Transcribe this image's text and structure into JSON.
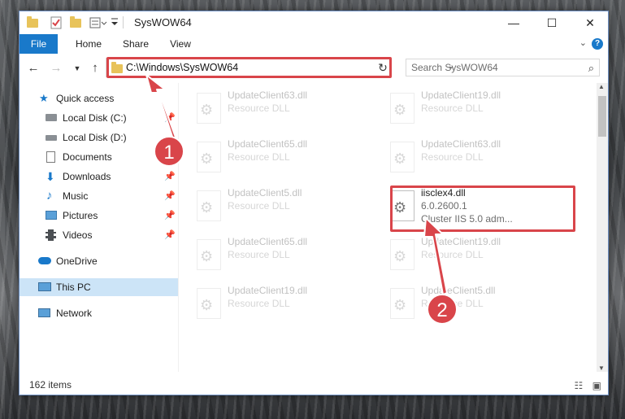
{
  "window": {
    "title": "SysWOW64",
    "controls": {
      "minimize": "—",
      "maximize": "☐",
      "close": "✕"
    }
  },
  "ribbon": {
    "tabs": [
      "File",
      "Home",
      "Share",
      "View"
    ],
    "help": "?"
  },
  "navigation": {
    "address": "C:\\Windows\\SysWOW64",
    "search_placeholder": "Search SysWOW64"
  },
  "sidebar": {
    "items": [
      {
        "label": "Quick access",
        "icon": "star-icon"
      },
      {
        "label": "Local Disk (C:)",
        "icon": "drive-icon",
        "pinned": true
      },
      {
        "label": "Local Disk (D:)",
        "icon": "drive-icon",
        "pinned": false
      },
      {
        "label": "Documents",
        "icon": "documents-icon",
        "pinned": true
      },
      {
        "label": "Downloads",
        "icon": "download-icon",
        "pinned": true
      },
      {
        "label": "Music",
        "icon": "music-icon",
        "pinned": true
      },
      {
        "label": "Pictures",
        "icon": "pictures-icon",
        "pinned": true
      },
      {
        "label": "Videos",
        "icon": "videos-icon",
        "pinned": true
      },
      {
        "label": "OneDrive",
        "icon": "cloud-icon"
      },
      {
        "label": "This PC",
        "icon": "computer-icon",
        "selected": true
      },
      {
        "label": "Network",
        "icon": "network-icon"
      }
    ]
  },
  "files": [
    {
      "name": "UpdateClient63.dll",
      "type": "Resource DLL"
    },
    {
      "name": "UpdateClient19.dll",
      "type": "Resource DLL"
    },
    {
      "name": "UpdateClient65.dll",
      "type": "Resource DLL"
    },
    {
      "name": "UpdateClient63.dll",
      "type": "Resource DLL"
    },
    {
      "name": "UpdateClient5.dll",
      "type": "Resource DLL"
    },
    {
      "name": "iisclex4.dll",
      "version": "6.0.2600.1",
      "type": "Cluster IIS 5.0 adm..."
    },
    {
      "name": "UpdateClient65.dll",
      "type": "Resource DLL"
    },
    {
      "name": "UpdateClient19.dll",
      "type": "Resource DLL"
    },
    {
      "name": "UpdateClient19.dll",
      "type": "Resource DLL"
    },
    {
      "name": "UpdateClient5.dll",
      "type": "Resource DLL"
    }
  ],
  "status": {
    "item_count": "162 items"
  },
  "annotations": {
    "step1": "1",
    "step2": "2",
    "color": "#d9454a"
  }
}
